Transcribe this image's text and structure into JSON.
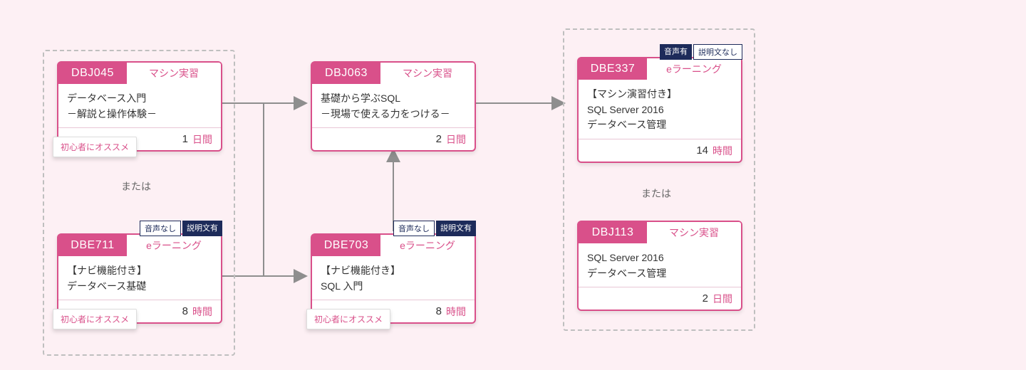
{
  "or_label": "または",
  "beginner_label": "初心者にオススメ",
  "tag_audio_no": "音声なし",
  "tag_audio_yes": "音声有",
  "tag_desc_yes": "説明文有",
  "tag_desc_no": "説明文なし",
  "cards": {
    "dbj045": {
      "code": "DBJ045",
      "type": "マシン実習",
      "title": "データベース入門\n－解説と操作体験－",
      "dur_n": "1",
      "dur_u": "日間"
    },
    "dbe711": {
      "code": "DBE711",
      "type": "eラーニング",
      "title": "【ナビ機能付き】\nデータベース基礎",
      "dur_n": "8",
      "dur_u": "時間"
    },
    "dbj063": {
      "code": "DBJ063",
      "type": "マシン実習",
      "title": "基礎から学ぶSQL\n－現場で使える力をつける－",
      "dur_n": "2",
      "dur_u": "日間"
    },
    "dbe703": {
      "code": "DBE703",
      "type": "eラーニング",
      "title": "【ナビ機能付き】\nSQL 入門",
      "dur_n": "8",
      "dur_u": "時間"
    },
    "dbe337": {
      "code": "DBE337",
      "type": "eラーニング",
      "title": "【マシン演習付き】\nSQL Server 2016\nデータベース管理",
      "dur_n": "14",
      "dur_u": "時間"
    },
    "dbj113": {
      "code": "DBJ113",
      "type": "マシン実習",
      "title": "SQL Server 2016\nデータベース管理",
      "dur_n": "2",
      "dur_u": "日間"
    }
  }
}
